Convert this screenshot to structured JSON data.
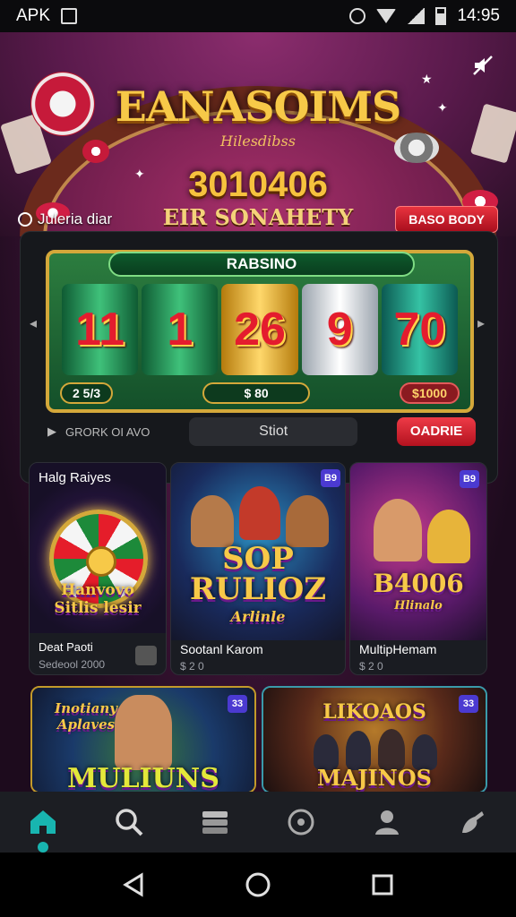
{
  "status_bar": {
    "carrier": "APK",
    "time": "14:95"
  },
  "hero": {
    "title": "EANASOIMS",
    "subtitle": "Hilesdibss",
    "number": "3010406",
    "tagline": "EIR SONAHETY",
    "link_label": "Juleria diar",
    "badge_label": "BASO BODY"
  },
  "slot": {
    "banner": "RABSINO",
    "reels": [
      "11",
      "1",
      "26",
      "9",
      "70"
    ],
    "values": [
      "2 5/3",
      "$ 80",
      "$1000"
    ],
    "control_label": "GRORK OI AVO",
    "field_value": "Stiot",
    "button_label": "OADRIE"
  },
  "tiles": [
    {
      "title": "Halg Raiyes",
      "art_text": "Hanvovo Sitlis lesir",
      "caption": "Deat Paoti",
      "sub": "Sedeool 2000",
      "badge": ""
    },
    {
      "title": "Sootanl Karom",
      "art_text": "SOP RULIOZ",
      "art_sub": "Arlinle",
      "sub": "$ 2 0",
      "badge": ""
    },
    {
      "title": "MultipHemam",
      "art_text": "B4006",
      "art_sub": "Hlinalo",
      "sub": "$ 2 0",
      "badge": "B9"
    },
    {
      "art_text": "MULIUNS",
      "art_top": "Inotiany Aplaves",
      "badge": "33"
    },
    {
      "art_text": "MAJINOS",
      "art_top": "LIKOAOS",
      "badge": "33"
    }
  ],
  "badges": {
    "t2": "B9",
    "t3": "B9"
  },
  "nav": [
    "home",
    "search",
    "stack",
    "wheel",
    "profile",
    "support"
  ],
  "colors": {
    "accent": "#18b5b0",
    "red": "#e8333f",
    "gold": "#f7c948"
  }
}
